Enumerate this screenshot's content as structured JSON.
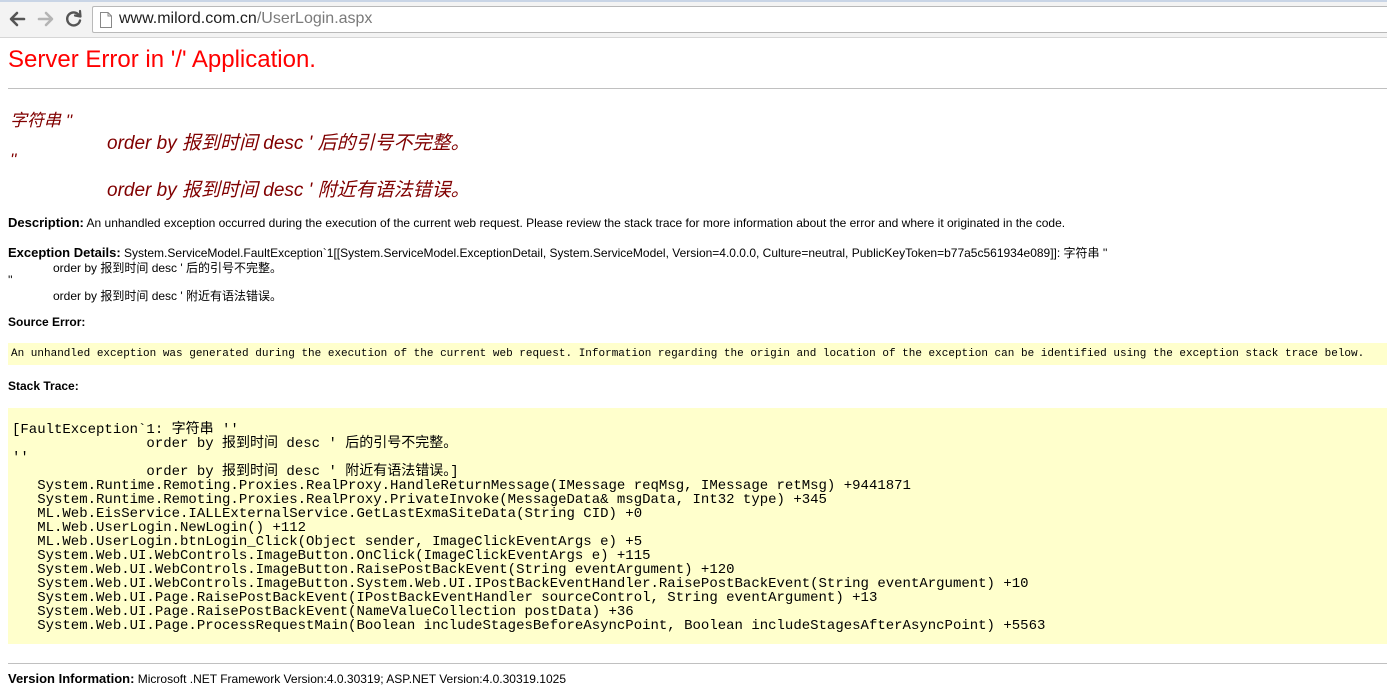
{
  "browser": {
    "url_host": "www.milord.com.cn",
    "url_path": "/UserLogin.aspx"
  },
  "page": {
    "title": "Server Error in '/' Application.",
    "error_lines": [
      "字符串 ''",
      "order by 报到时间 desc ' 后的引号不完整。",
      "''",
      "order by 报到时间 desc ' 附近有语法错误。"
    ],
    "description_label": "Description:",
    "description_text": "An unhandled exception occurred during the execution of the current web request. Please review the stack trace for more information about the error and where it originated in the code.",
    "exception_label": "Exception Details:",
    "exception_lines": [
      "System.ServiceModel.FaultException`1[[System.ServiceModel.ExceptionDetail, System.ServiceModel, Version=4.0.0.0, Culture=neutral, PublicKeyToken=b77a5c561934e089]]: 字符串 ''",
      "order by 报到时间 desc ' 后的引号不完整。",
      "''",
      "order by 报到时间 desc ' 附近有语法错误。"
    ],
    "source_error_label": "Source Error:",
    "source_error_text": "An unhandled exception was generated during the execution of the current web request. Information regarding the origin and location of the exception can be identified using the exception stack trace below.",
    "stack_trace_label": "Stack Trace:",
    "stack_trace": "[FaultException`1: 字符串 ''\n                order by 报到时间 desc ' 后的引号不完整。\n''\n                order by 报到时间 desc ' 附近有语法错误。]\n   System.Runtime.Remoting.Proxies.RealProxy.HandleReturnMessage(IMessage reqMsg, IMessage retMsg) +9441871\n   System.Runtime.Remoting.Proxies.RealProxy.PrivateInvoke(MessageData& msgData, Int32 type) +345\n   ML.Web.EisService.IALLExternalService.GetLastExmaSiteData(String CID) +0\n   ML.Web.UserLogin.NewLogin() +112\n   ML.Web.UserLogin.btnLogin_Click(Object sender, ImageClickEventArgs e) +5\n   System.Web.UI.WebControls.ImageButton.OnClick(ImageClickEventArgs e) +115\n   System.Web.UI.WebControls.ImageButton.RaisePostBackEvent(String eventArgument) +120\n   System.Web.UI.WebControls.ImageButton.System.Web.UI.IPostBackEventHandler.RaisePostBackEvent(String eventArgument) +10\n   System.Web.UI.Page.RaisePostBackEvent(IPostBackEventHandler sourceControl, String eventArgument) +13\n   System.Web.UI.Page.RaisePostBackEvent(NameValueCollection postData) +36\n   System.Web.UI.Page.ProcessRequestMain(Boolean includeStagesBeforeAsyncPoint, Boolean includeStagesAfterAsyncPoint) +5563",
    "version_label": "Version Information:",
    "version_text": "Microsoft .NET Framework Version:4.0.30319; ASP.NET Version:4.0.30319.1025"
  }
}
